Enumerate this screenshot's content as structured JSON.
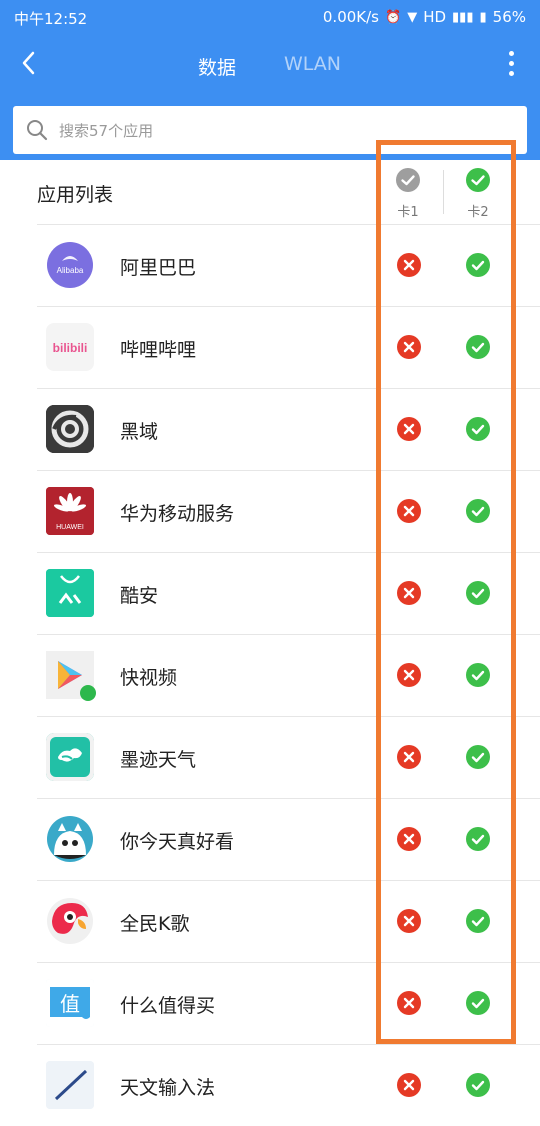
{
  "status": {
    "time": "中午12:52",
    "speed": "0.00K/s",
    "network": "HD",
    "battery": "56%"
  },
  "nav": {
    "tab_data": "数据",
    "tab_wlan": "WLAN"
  },
  "search": {
    "placeholder": "搜索57个应用"
  },
  "list": {
    "title": "应用列表",
    "col1": "卡1",
    "col2": "卡2",
    "apps": [
      {
        "name": "阿里巴巴",
        "card1": "blocked",
        "card2": "allowed"
      },
      {
        "name": "哔哩哔哩",
        "card1": "blocked",
        "card2": "allowed"
      },
      {
        "name": "黑域",
        "card1": "blocked",
        "card2": "allowed"
      },
      {
        "name": "华为移动服务",
        "card1": "blocked",
        "card2": "allowed"
      },
      {
        "name": "酷安",
        "card1": "blocked",
        "card2": "allowed"
      },
      {
        "name": "快视频",
        "card1": "blocked",
        "card2": "allowed"
      },
      {
        "name": "墨迹天气",
        "card1": "blocked",
        "card2": "allowed"
      },
      {
        "name": "你今天真好看",
        "card1": "blocked",
        "card2": "allowed"
      },
      {
        "name": "全民K歌",
        "card1": "blocked",
        "card2": "allowed"
      },
      {
        "name": "什么值得买",
        "card1": "blocked",
        "card2": "allowed"
      },
      {
        "name": "天文输入法",
        "card1": "blocked",
        "card2": "allowed"
      }
    ],
    "icon_texts": {
      "alibaba": "Alibaba",
      "bilibili": "bilibili",
      "huawei": "HUAWEI",
      "smzdm": "值"
    }
  },
  "colors": {
    "header": "#3d8ff2",
    "allowed": "#3dbf4a",
    "blocked": "#e53a25",
    "highlight": "#f07a30"
  },
  "icons": [
    "back-arrow-icon",
    "more-vertical-icon",
    "search-icon",
    "check-icon",
    "cross-icon"
  ]
}
